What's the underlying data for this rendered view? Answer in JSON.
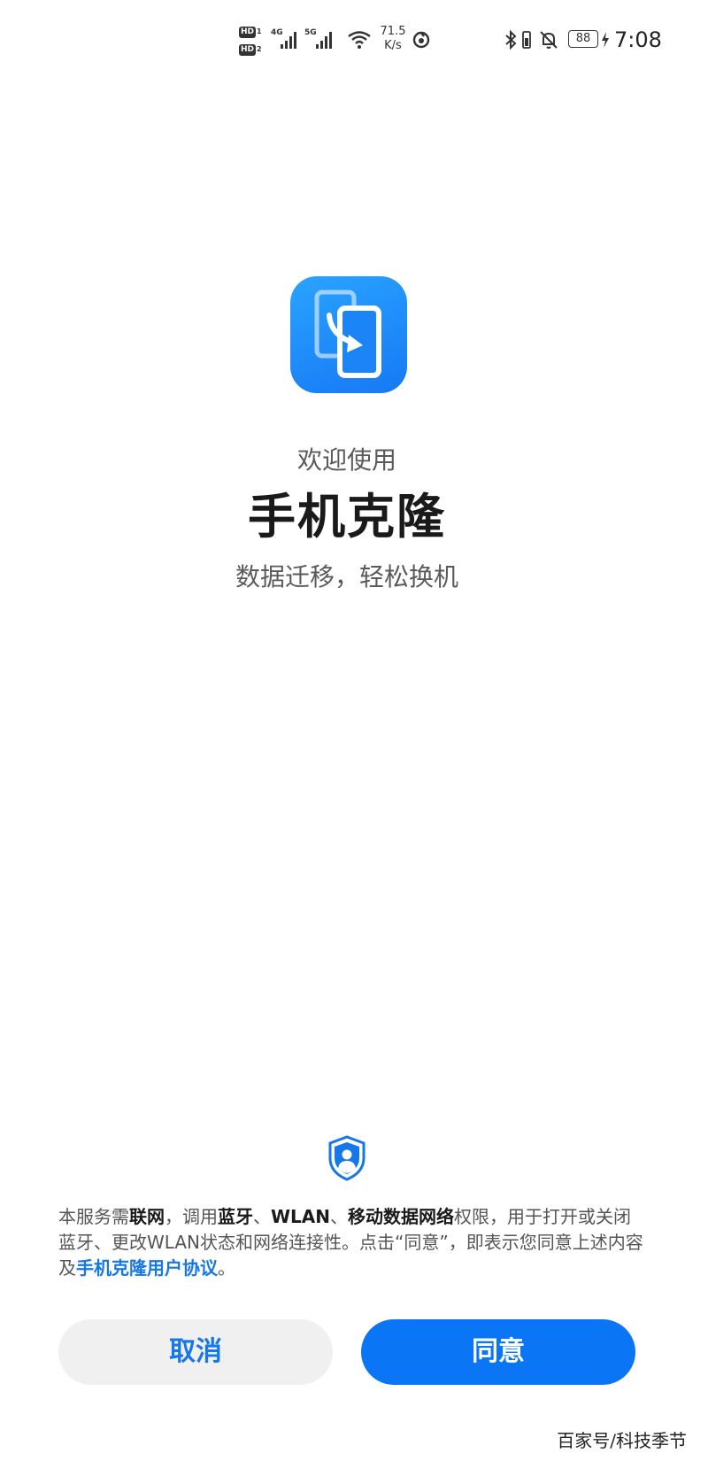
{
  "status_bar": {
    "hd1_label": "HD",
    "hd1_sub": "1",
    "hd2_label": "HD",
    "hd2_sub": "2",
    "network1": "4G",
    "network2": "5G",
    "speed_value": "71.5",
    "speed_unit": "K/s",
    "battery_level": "88",
    "time": "7:08",
    "icons": [
      "signal-bars-icon",
      "wifi-icon",
      "music-app-icon",
      "bluetooth-icon",
      "vibrate-icon",
      "mute-bell-icon",
      "battery-icon",
      "charging-icon"
    ]
  },
  "app": {
    "icon": "phone-clone-icon",
    "welcome": "欢迎使用",
    "title": "手机克隆",
    "tagline": "数据迁移，轻松换机"
  },
  "privacy": {
    "icon": "privacy-shield-icon",
    "parts": {
      "p1": "本服务需",
      "b1": "联网",
      "p2": "，调用",
      "b2": "蓝牙",
      "p3": "、",
      "b3": "WLAN",
      "p4": "、",
      "b4": "移动数据网络",
      "p5": "权限，用于打开或关闭蓝牙、更改WLAN状态和网络连接性。点击“同意”，即表示您同意上述内容及",
      "link": "手机克隆用户协议",
      "p6": "。"
    }
  },
  "buttons": {
    "cancel_label": "取消",
    "agree_label": "同意"
  },
  "watermark": "百家号/科技季节",
  "colors": {
    "accent": "#0a76f5",
    "link": "#1677e8",
    "cancel_bg": "#f0f0f0"
  }
}
